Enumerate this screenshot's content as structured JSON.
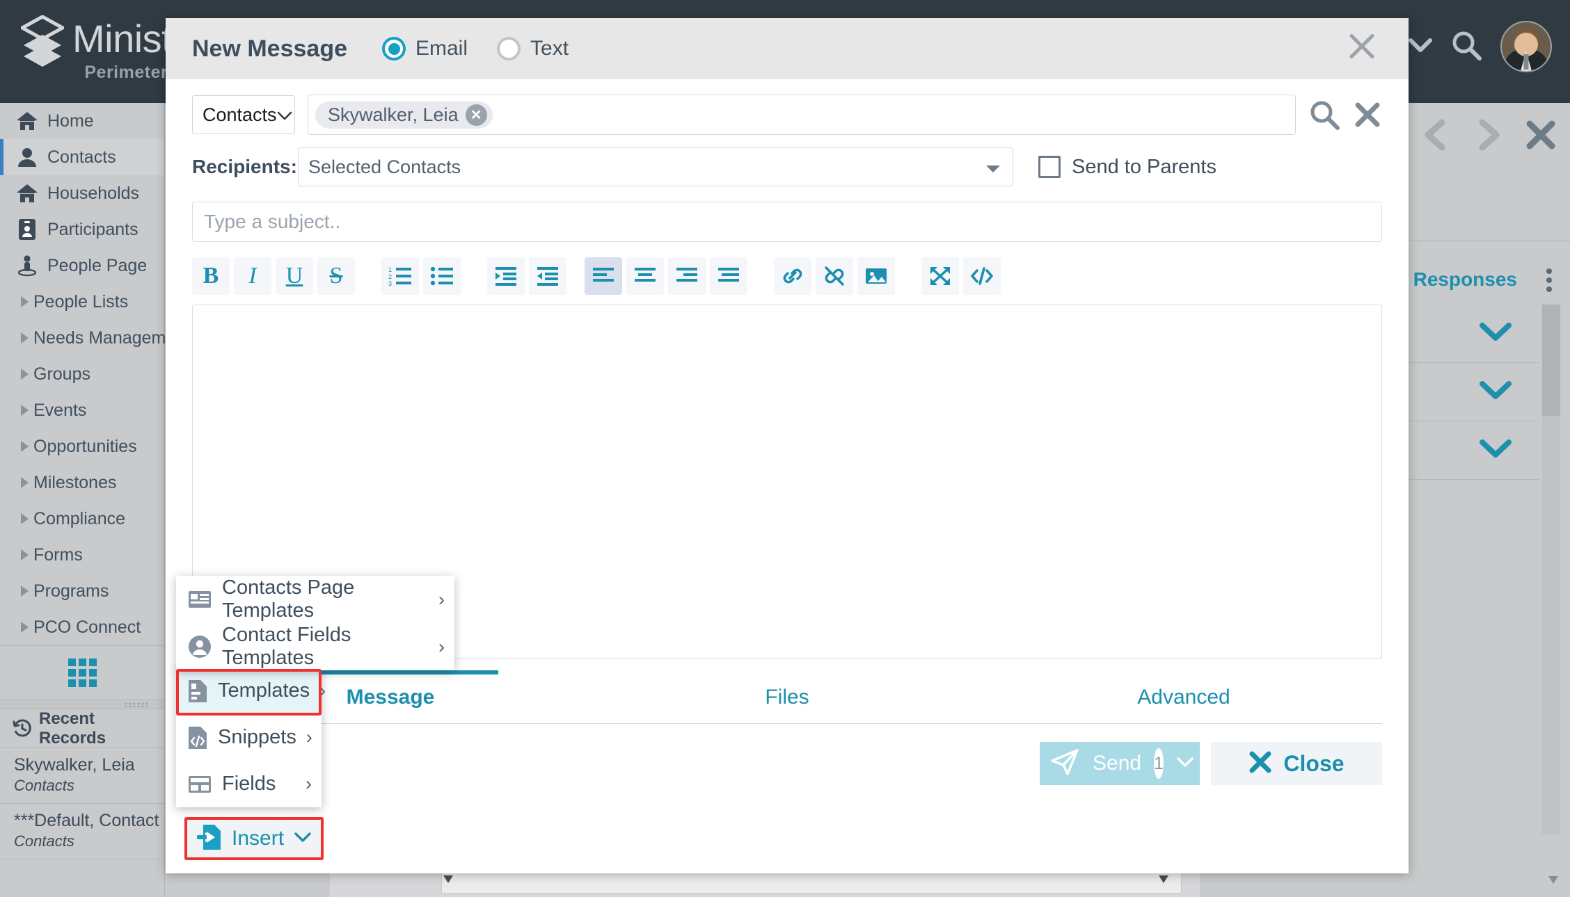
{
  "app": {
    "logo_title": "Minist",
    "logo_subtitle": "Perimeter"
  },
  "sidebar": {
    "items": [
      {
        "label": "Home",
        "icon": "home-icon",
        "type": "icon",
        "active": false
      },
      {
        "label": "Contacts",
        "icon": "person-icon",
        "type": "icon",
        "active": true
      },
      {
        "label": "Households",
        "icon": "home-icon",
        "type": "icon",
        "active": false
      },
      {
        "label": "Participants",
        "icon": "badge-icon",
        "type": "icon",
        "active": false
      },
      {
        "label": "People Page",
        "icon": "people-page-icon",
        "type": "icon",
        "active": false
      },
      {
        "label": "People Lists",
        "icon": "caret-right-icon",
        "type": "caret",
        "active": false
      },
      {
        "label": "Needs Management",
        "icon": "caret-right-icon",
        "type": "caret",
        "active": false
      },
      {
        "label": "Groups",
        "icon": "caret-right-icon",
        "type": "caret",
        "active": false
      },
      {
        "label": "Events",
        "icon": "caret-right-icon",
        "type": "caret",
        "active": false
      },
      {
        "label": "Opportunities",
        "icon": "caret-right-icon",
        "type": "caret",
        "active": false
      },
      {
        "label": "Milestones",
        "icon": "caret-right-icon",
        "type": "caret",
        "active": false
      },
      {
        "label": "Compliance",
        "icon": "caret-right-icon",
        "type": "caret",
        "active": false
      },
      {
        "label": "Forms",
        "icon": "caret-right-icon",
        "type": "caret",
        "active": false
      },
      {
        "label": "Programs",
        "icon": "caret-right-icon",
        "type": "caret",
        "active": false
      },
      {
        "label": "PCO Connect",
        "icon": "caret-right-icon",
        "type": "caret",
        "active": false
      }
    ],
    "apps_grid_icon": "grid-icon",
    "recent": {
      "title": "Recent Records",
      "icon": "history-icon",
      "items": [
        {
          "name": "Skywalker, Leia",
          "type": "Contacts"
        },
        {
          "name": "***Default, Contact",
          "type": "Contacts"
        }
      ]
    }
  },
  "background": {
    "prev_icon": "chevron-left-icon",
    "next_icon": "chevron-right-icon",
    "close_icon": "close-icon",
    "form_responses_title": "orm Responses",
    "kebab_icon": "kebab-menu-icon",
    "row_chevron_icon": "chevron-down-icon",
    "row_count": 3
  },
  "modal": {
    "title": "New Message",
    "close_icon": "close-icon",
    "message_type": {
      "selected": "Email",
      "options": [
        {
          "label": "Email",
          "selected": true
        },
        {
          "label": "Text",
          "selected": false
        }
      ]
    },
    "source_select": {
      "value": "Contacts",
      "chevron_icon": "chevron-down-icon"
    },
    "chips": [
      {
        "label": "Skywalker, Leia",
        "remove_icon": "close-icon"
      }
    ],
    "search_icon": "search-icon",
    "clear_icon": "close-icon",
    "recipients": {
      "label": "Recipients:",
      "value": "Selected Contacts",
      "chevron_icon": "chevron-down-icon"
    },
    "send_to_parents": {
      "label": "Send to Parents",
      "checked": false
    },
    "subject": {
      "placeholder": "Type a subject..",
      "value": ""
    },
    "toolbar": [
      {
        "name": "bold-icon",
        "label": "B",
        "active": false
      },
      {
        "name": "italic-icon",
        "label": "I",
        "active": false
      },
      {
        "name": "underline-icon",
        "label": "U",
        "active": false
      },
      {
        "name": "strikethrough-icon",
        "label": "S",
        "active": false
      },
      {
        "name": "ordered-list-icon",
        "label": "",
        "active": false
      },
      {
        "name": "unordered-list-icon",
        "label": "",
        "active": false
      },
      {
        "name": "indent-icon",
        "label": "",
        "active": false
      },
      {
        "name": "outdent-icon",
        "label": "",
        "active": false
      },
      {
        "name": "align-left-icon",
        "label": "",
        "active": true
      },
      {
        "name": "align-center-icon",
        "label": "",
        "active": false
      },
      {
        "name": "align-right-icon",
        "label": "",
        "active": false
      },
      {
        "name": "align-justify-icon",
        "label": "",
        "active": false
      },
      {
        "name": "link-icon",
        "label": "",
        "active": false
      },
      {
        "name": "unlink-icon",
        "label": "",
        "active": false
      },
      {
        "name": "image-icon",
        "label": "",
        "active": false
      },
      {
        "name": "fullscreen-icon",
        "label": "",
        "active": false
      },
      {
        "name": "source-code-icon",
        "label": "",
        "active": false
      }
    ],
    "editor_body": "",
    "tabs": [
      {
        "label": "Message",
        "active": true
      },
      {
        "label": "Files",
        "active": false
      },
      {
        "label": "Advanced",
        "active": false
      }
    ],
    "send_button": {
      "label": "Send",
      "count": "1",
      "icon": "send-plane-icon",
      "chevron_icon": "chevron-down-icon"
    },
    "close_button": {
      "label": "Close",
      "icon": "close-icon"
    }
  },
  "insert_menu": {
    "trigger": {
      "label": "Insert",
      "icon": "insert-file-icon",
      "chevron_icon": "chevron-down-icon"
    },
    "items": [
      {
        "label": "Templates",
        "icon": "template-file-icon",
        "chevron": "›",
        "highlighted": true
      },
      {
        "label": "Snippets",
        "icon": "snippet-code-icon",
        "chevron": "›",
        "highlighted": false
      },
      {
        "label": "Fields",
        "icon": "table-fields-icon",
        "chevron": "›",
        "highlighted": false
      }
    ],
    "submenu": [
      {
        "label": "Contacts Page Templates",
        "icon": "page-template-icon",
        "chevron": "›"
      },
      {
        "label": "Contact Fields Templates",
        "icon": "person-circle-icon",
        "chevron": "›"
      }
    ]
  },
  "colors": {
    "accent": "#1b8fad",
    "dark_header": "#2f3a43",
    "sidebar_bg": "#c8cacc",
    "highlight_red": "#f0302f",
    "active_blue": "#3a7fc1"
  }
}
